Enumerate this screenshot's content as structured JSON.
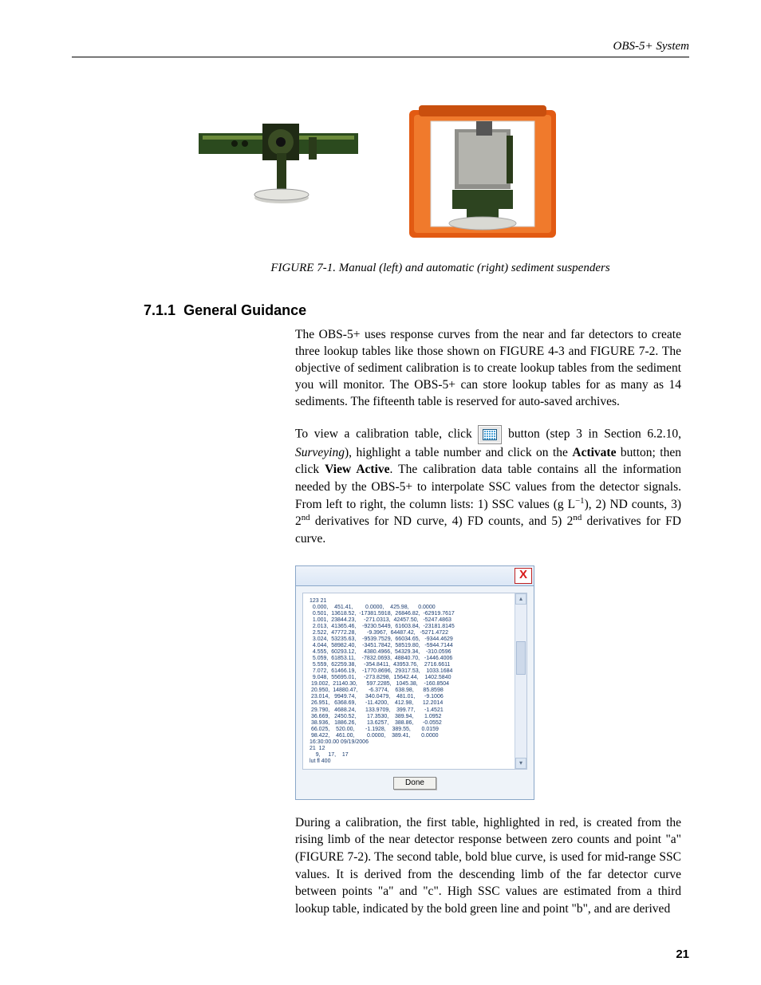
{
  "header": {
    "doc_title": "OBS-5+ System"
  },
  "figure": {
    "caption": "FIGURE 7-1.  Manual (left) and automatic (right) sediment suspenders"
  },
  "section": {
    "number": "7.1.1",
    "title": "General Guidance"
  },
  "paragraphs": {
    "p1": "The OBS-5+ uses response curves from the near and far detectors to create three lookup tables like those shown on FIGURE 4-3 and FIGURE 7-2.  The objective of sediment calibration is to create lookup tables from the sediment you will monitor.  The OBS-5+ can store lookup tables for as many as 14 sediments.  The fifteenth table is reserved for auto-saved archives.",
    "p2_pre": "To view a calibration table, click ",
    "p2_post_a": " button (step 3 in Section 6.2.10, ",
    "p2_post_b": "Surveying",
    "p2_post_c": "), highlight a table number and click on the ",
    "p2_post_d": "Activate",
    "p2_post_e": " button; then click ",
    "p2_post_f": "View Active",
    "p2_post_g": ".  The calibration data table contains all the information needed by the OBS-5+ to interpolate SSC values from the detector signals.  From left to right, the column lists: 1) SSC values (g L",
    "p2_post_h": "), 2) ND counts, 3) 2",
    "p2_post_i": " derivatives for ND curve, 4) FD counts, and 5) 2",
    "p2_post_j": " derivatives for FD curve.",
    "p3": "During a calibration, the first table, highlighted in red, is created from the rising limb of the near detector response between zero counts and point \"a\" (FIGURE 7-2).  The second table, bold blue curve, is used for mid-range SSC values.  It is derived from the descending limb of the far detector curve between points \"a\" and \"c\".  High SSC values are estimated from a third lookup table, indicated by the bold green line and point \"b\", and are derived"
  },
  "dialog": {
    "close_label": "X",
    "done_label": "Done",
    "table_text": "123 21\n  0.000,    451.41,        0.0000,    425.98,      0.0000\n  0.501,  13618.52,  -17381.5918,  26846.82,  -62919.7617\n  1.001,  23844.23,     -271.0313,  42457.50,   -5247.4863\n  2.013,  41365.46,    -9230.5449,  61603.84,  -23181.8145\n  2.522,  47772.28,       -9.3967,  64487.42,   -5271.4722\n  3.024,  53235.63,    -9539.7529,  66034.65,   -9344.4629\n  4.044,  58982.40,    -3451.7842,  58519.80,   -5944.7144\n  4.555,  60293.12,     4380.4966,  54329.34,    -310.0596\n  5.059,  61853.11,    -7832.0693,  48840.70,   -1446.4006\n  5.559,  62259.38,     -354.8411,  43953.76,    2716.6611\n  7.072,  61466.19,    -1770.8696,  29317.53,    1033.1684\n  9.048,  55695.01,     -273.8298,  15642.44,    1402.5840\n 19.002,  21140.30,      597.2285,   1045.38,    -160.8504\n 20.950,  14880.47,       -6.3774,    638.98,      85.8598\n 23.014,   9949.74,      340.0479,    481.01,      -9.1006\n 26.951,   6368.69,      -11.4200,    412.98,      12.2014\n 29.790,   4688.24,      133.9709,    399.77,      -1.4521\n 36.669,   2450.52,       17.3530,    389.94,       1.0952\n 38.936,   1886.26,       13.6257,    388.86,      -0.0552\n 66.025,    520.00,       -1.1928,    389.55,       0.0159\n 98.422,    461.00,        0.0000,    389.41,       0.0000\n16:30:00.00 09/19/2006\n21  12\n    9,     17,    17\nlut fl 400"
  },
  "page_number": "21"
}
